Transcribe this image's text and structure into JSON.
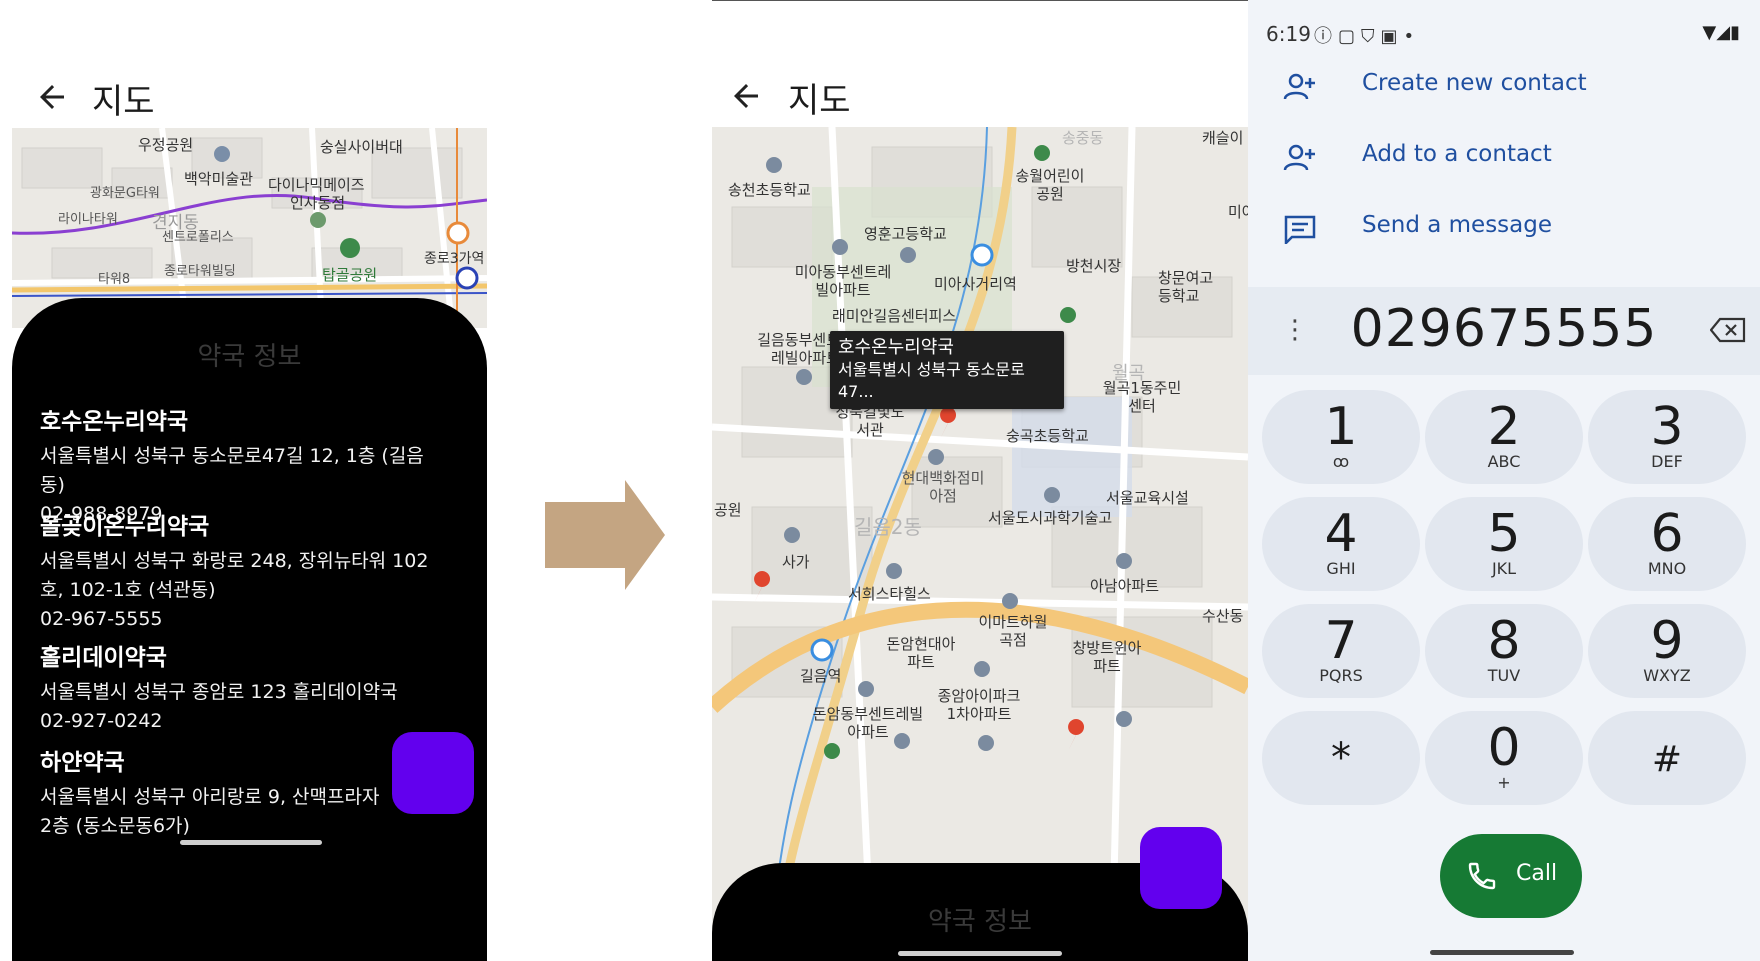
{
  "panel1": {
    "title": "지도",
    "map_labels": [
      "우정공원",
      "숭실사이버대",
      "백악미술관",
      "다이나믹메이즈",
      "인사동점",
      "광화문G타워",
      "라이나타워",
      "견지동",
      "센트로폴리스",
      "종로타워빌딩",
      "탑골공원",
      "종로3가역",
      "타워8"
    ],
    "sheet_title": "약국 정보",
    "pharmacies": [
      {
        "name": "호수온누리약국",
        "address": "서울특별시 성북구 동소문로47길 12, 1층 (길음동)",
        "phone": "02-988-8979"
      },
      {
        "name": "돌곶이온누리약국",
        "address": "서울특별시 성북구 화랑로 248, 장위뉴타워 102호, 102-1호 (석관동)",
        "phone": "02-967-5555"
      },
      {
        "name": "홀리데이약국",
        "address": "서울특별시 성북구 종암로 123 홀리데이약국",
        "phone": "02-927-0242"
      },
      {
        "name": "하얀약국",
        "address": "서울특별시 성북구 아리랑로 9, 산맥프라자 2층 (동소문동6가)",
        "phone": ""
      }
    ],
    "fab_color": "#6200ee"
  },
  "flow_arrow_color": "#c4a582",
  "panel2": {
    "title": "지도",
    "callout": {
      "name": "호수온누리약국",
      "address": "서울특별시 성북구 동소문로47..."
    },
    "map_labels": [
      "송천초등학교",
      "송월어린이공원",
      "영훈고등학교",
      "미아동부센트레빌아파트",
      "미아사거리역",
      "방천시장",
      "창문여고등학교",
      "래미안길음센터피스",
      "길음동부센트레빌아파트",
      "성북길빛도서관",
      "현대백화점미아점",
      "숭곡초등학교",
      "월곡1동주민센터",
      "서울도시과학기술고",
      "서울교육시설",
      "길음2동",
      "사가",
      "서희스타힐스",
      "이마트하월곡점",
      "아남아파트",
      "돈암현대아파트",
      "길음역",
      "종암아이파크1차아파트",
      "창방트윈아파트",
      "돈암동부센트레빌아파트",
      "수산동",
      "송중동",
      "캐슬이",
      "미아",
      "공원",
      "월곡"
    ],
    "sheet_title": "약국 정보"
  },
  "panel3": {
    "status_time": "6:19",
    "actions": [
      {
        "label": "Create new contact",
        "icon": "person-add-icon"
      },
      {
        "label": "Add to a contact",
        "icon": "person-add-icon"
      },
      {
        "label": "Send a message",
        "icon": "message-icon"
      }
    ],
    "number": "029675555",
    "keys": [
      {
        "digit": "1",
        "letters": "ꝏ"
      },
      {
        "digit": "2",
        "letters": "ABC"
      },
      {
        "digit": "3",
        "letters": "DEF"
      },
      {
        "digit": "4",
        "letters": "GHI"
      },
      {
        "digit": "5",
        "letters": "JKL"
      },
      {
        "digit": "6",
        "letters": "MNO"
      },
      {
        "digit": "7",
        "letters": "PQRS"
      },
      {
        "digit": "8",
        "letters": "TUV"
      },
      {
        "digit": "9",
        "letters": "WXYZ"
      },
      {
        "digit": "*",
        "letters": ""
      },
      {
        "digit": "0",
        "letters": "+"
      },
      {
        "digit": "#",
        "letters": ""
      }
    ],
    "call_label": "Call",
    "call_color": "#167a34"
  }
}
